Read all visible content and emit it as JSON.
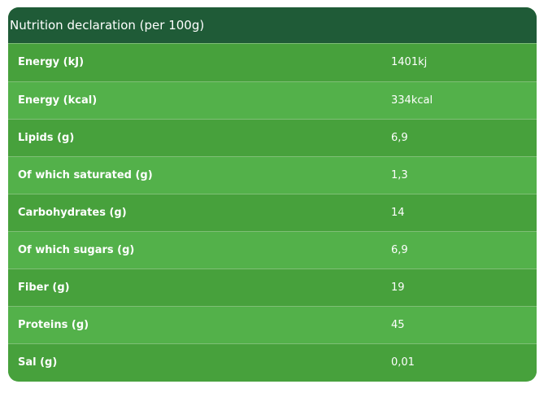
{
  "table": {
    "title": "Nutrition declaration (per 100g)",
    "rows": [
      {
        "label": "Energy (kJ)",
        "value": "1401kj"
      },
      {
        "label": "Energy (kcal)",
        "value": "334kcal"
      },
      {
        "label": "Lipids (g)",
        "value": "6,9"
      },
      {
        "label": "Of which saturated (g)",
        "value": "1,3"
      },
      {
        "label": "Carbohydrates (g)",
        "value": "14"
      },
      {
        "label": "Of which sugars (g)",
        "value": "6,9"
      },
      {
        "label": "Fiber (g)",
        "value": "19"
      },
      {
        "label": "Proteins (g)",
        "value": "45"
      },
      {
        "label": "Sal (g)",
        "value": "0,01"
      }
    ]
  },
  "colors": {
    "header_bg": "#1f5b37",
    "row_dark": "#47a13c",
    "row_light": "#53b14a",
    "text": "#ffffff"
  }
}
